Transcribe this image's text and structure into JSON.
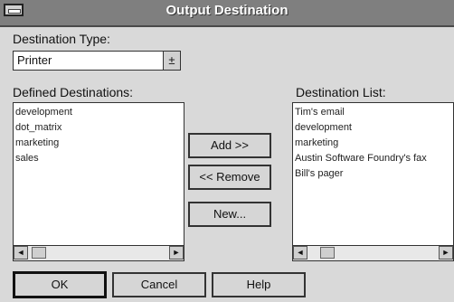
{
  "dialog": {
    "title": "Output Destination"
  },
  "destination_type": {
    "label": "Destination Type:",
    "value": "Printer",
    "arrow": "±"
  },
  "defined": {
    "label": "Defined Destinations:",
    "items": [
      "development",
      "dot_matrix",
      "marketing",
      "sales"
    ]
  },
  "dest_list": {
    "label": "Destination List:",
    "items": [
      "Tim's email",
      "development",
      "marketing",
      "Austin Software Foundry's fax",
      "Bill's pager"
    ]
  },
  "buttons": {
    "add": "Add >>",
    "remove": "<< Remove",
    "new": "New...",
    "ok": "OK",
    "cancel": "Cancel",
    "help": "Help"
  },
  "scroll": {
    "left": "◄",
    "right": "►"
  }
}
